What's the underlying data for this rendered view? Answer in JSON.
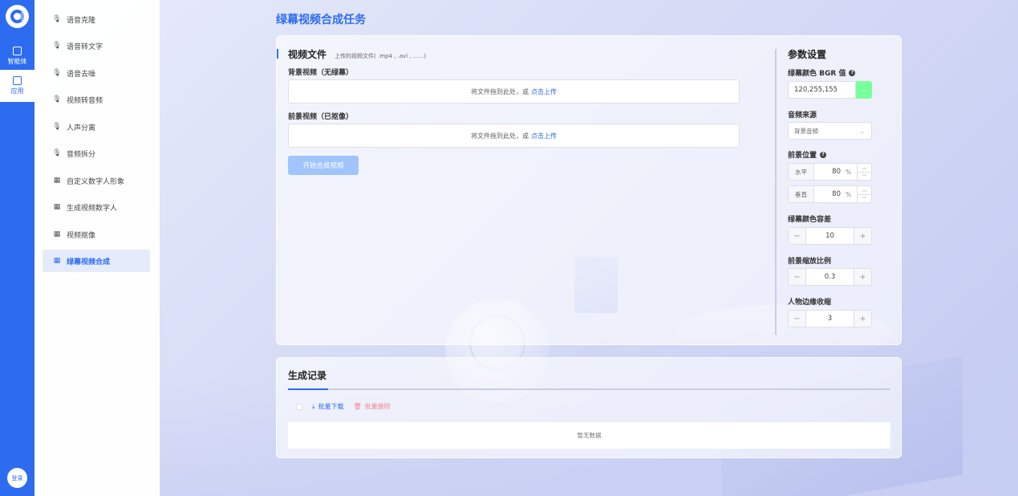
{
  "rail": {
    "items": [
      {
        "label": "智能体",
        "icon": "robot-icon"
      },
      {
        "label": "应用",
        "icon": "apps-icon"
      }
    ],
    "login_label": "登录"
  },
  "menu": {
    "items": [
      {
        "label": "语音克隆",
        "icon": "mic-icon"
      },
      {
        "label": "语音转文字",
        "icon": "mic-icon"
      },
      {
        "label": "语音去噪",
        "icon": "mic-icon"
      },
      {
        "label": "视频转音频",
        "icon": "mic-icon"
      },
      {
        "label": "人声分离",
        "icon": "mic-icon"
      },
      {
        "label": "音频拆分",
        "icon": "mic-icon"
      },
      {
        "label": "自定义数字人形象",
        "icon": "film-icon"
      },
      {
        "label": "生成视频数字人",
        "icon": "film-icon"
      },
      {
        "label": "视频抠像",
        "icon": "film-icon"
      },
      {
        "label": "绿幕视频合成",
        "icon": "film-icon",
        "active": true
      }
    ]
  },
  "page": {
    "title": "绿幕视频合成任务"
  },
  "video": {
    "title": "视频文件",
    "hint": "上传的视频文件( .mp4 , .avi , ......)",
    "bg_label": "背景视频（无绿幕）",
    "fg_label": "前景视频（已抠像）",
    "upload_text": "将文件拖到此处，或",
    "upload_link": "点击上传",
    "start_button": "开始合成视频"
  },
  "params": {
    "title": "参数设置",
    "color_label": "绿幕颜色 BGR 值",
    "color_value": "120,255,155",
    "color_swatch": "#78ff9b",
    "audio_label": "音频来源",
    "audio_value": "背景音频",
    "pos_label": "前景位置",
    "horizontal_label": "水平",
    "horizontal_value": "80",
    "vertical_label": "垂直",
    "vertical_value": "80",
    "unit": "%",
    "tolerance_label": "绿幕颜色容差",
    "tolerance_value": "10",
    "scale_label": "前景缩放比例",
    "scale_value": "0.3",
    "edge_label": "人物边缘收缩",
    "edge_value": "3"
  },
  "records": {
    "title": "生成记录",
    "download_label": "批量下载",
    "delete_label": "批量删除",
    "empty_text": "暂无数据"
  },
  "colors": {
    "accent": "#2d6cf0",
    "danger": "#f56c6c"
  }
}
